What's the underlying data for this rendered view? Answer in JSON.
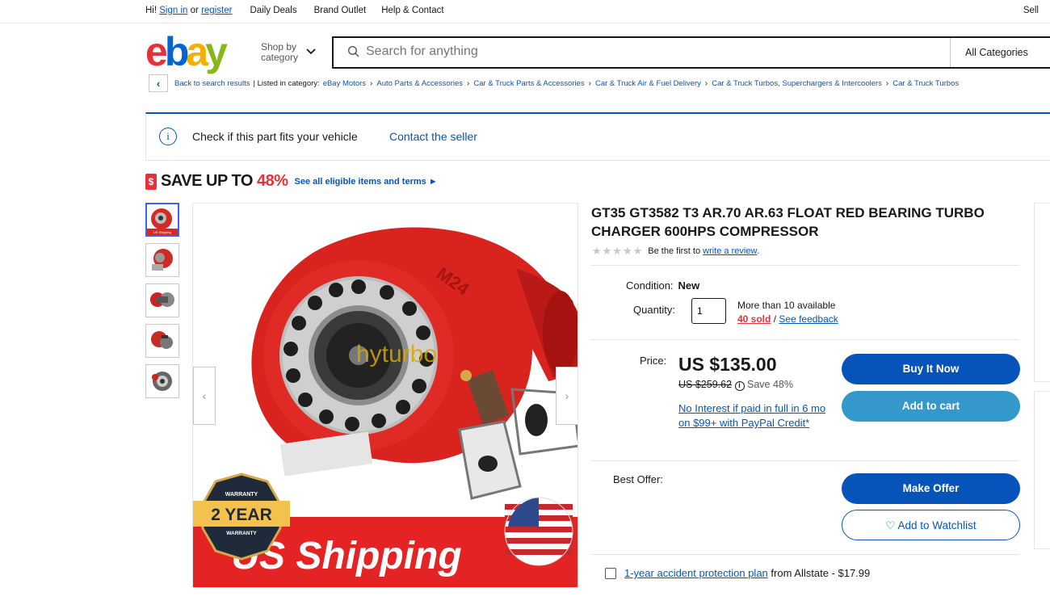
{
  "topbar": {
    "hi": "Hi!",
    "sign_in": "Sign in",
    "or": "or",
    "register": "register",
    "links": [
      "Daily Deals",
      "Brand Outlet",
      "Help & Contact"
    ],
    "sell": "Sell"
  },
  "header": {
    "logo": {
      "e": "e",
      "b": "b",
      "a": "a",
      "y": "y"
    },
    "shop_by_line1": "Shop by",
    "shop_by_line2": "category",
    "search_placeholder": "Search for anything",
    "category": "All Categories"
  },
  "breadcrumb": {
    "back": "Back to search results",
    "listed_in": "Listed in category:",
    "items": [
      "eBay Motors",
      "Auto Parts & Accessories",
      "Car & Truck Parts & Accessories",
      "Car & Truck Air & Fuel Delivery",
      "Car & Truck Turbos, Superchargers & Intercoolers",
      "Car & Truck Turbos"
    ]
  },
  "fitment": {
    "check": "Check if this part fits your vehicle",
    "contact": "Contact the seller"
  },
  "promo": {
    "save_text": "SAVE UP TO",
    "save_pct": "48%",
    "link": "See all eligible items and terms ►"
  },
  "gallery": {
    "watermark": "hyturbo",
    "warranty_top": "WARRANTY",
    "warranty_main": "2 YEAR",
    "warranty_bottom": "WARRANTY",
    "banner": "US Shipping",
    "thumb_badge": "US Shipping"
  },
  "product": {
    "title": "GT35 GT3582 T3 AR.70 AR.63 FLOAT RED BEARING TURBO CHARGER 600HPS COMPRESSOR",
    "review_prefix": "Be the first to",
    "review_link": "write a review",
    "review_suffix": ".",
    "condition_label": "Condition:",
    "condition_value": "New",
    "quantity_label": "Quantity:",
    "quantity_value": "1",
    "available": "More than 10 available",
    "sold": "40 sold",
    "slash": "/",
    "feedback": "See feedback",
    "price_label": "Price:",
    "price": "US $135.00",
    "orig_price": "US $259.62",
    "save": "Save 48%",
    "interest": "No Interest if paid in full in 6 mo on $99+ with PayPal Credit*",
    "buy_now": "Buy It Now",
    "add_cart": "Add to cart",
    "best_offer_label": "Best Offer:",
    "make_offer": "Make Offer",
    "watchlist": "♡ Add to Watchlist",
    "protection_link": "1-year accident protection plan",
    "protection_rest": "from Allstate - $17.99"
  },
  "colors": {
    "accent": "#0654ba",
    "secondary": "#3498ca",
    "red": "#e53238"
  }
}
